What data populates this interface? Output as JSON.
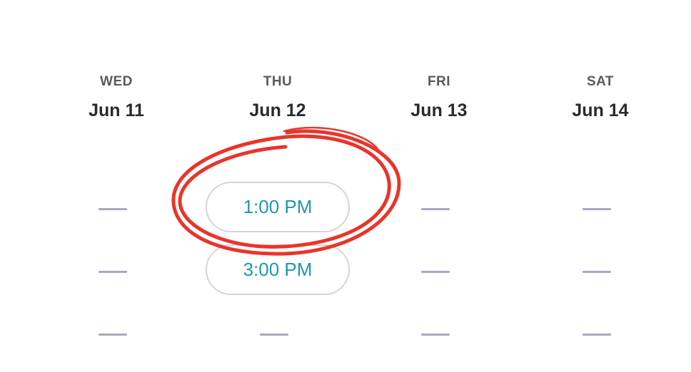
{
  "days": [
    {
      "weekday": "WED",
      "date": "Jun 11",
      "slots": []
    },
    {
      "weekday": "THU",
      "date": "Jun 12",
      "slots": [
        "1:00 PM",
        "3:00 PM"
      ]
    },
    {
      "weekday": "FRI",
      "date": "Jun 13",
      "slots": []
    },
    {
      "weekday": "SAT",
      "date": "Jun 14",
      "slots": []
    }
  ],
  "colors": {
    "slot_text": "#1c9aa8",
    "slot_border": "#d5d5d5",
    "unavailable_dash": "#a7a9c2",
    "highlight_circle": "#e8352b"
  }
}
